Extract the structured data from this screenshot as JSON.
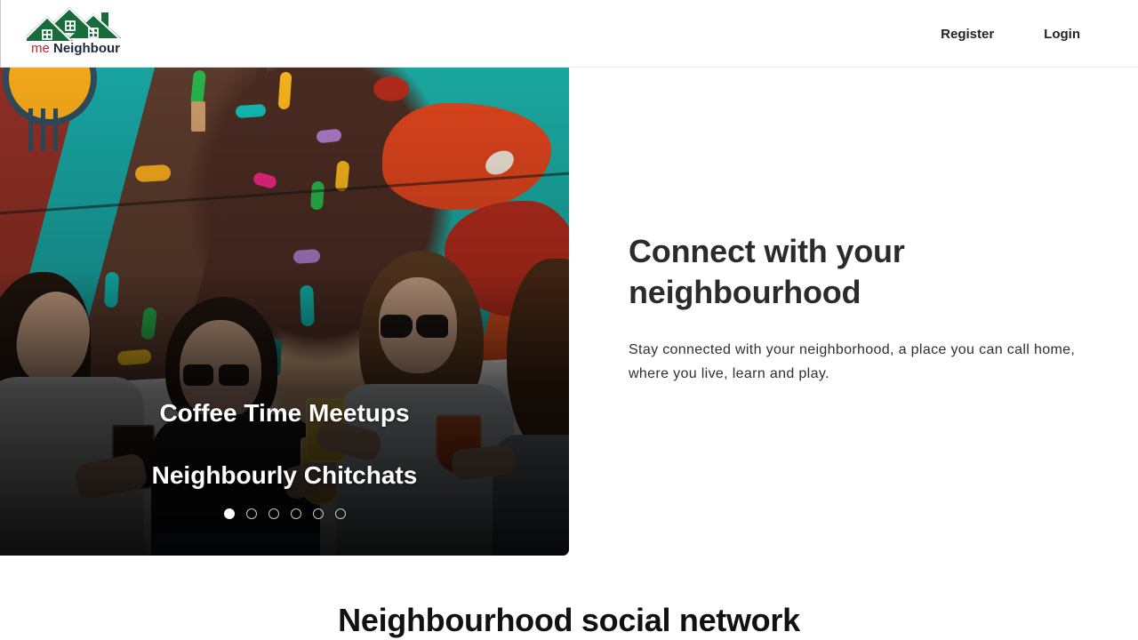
{
  "header": {
    "brand": {
      "icon": "house-roofs-logo-icon",
      "word_primary": "me",
      "word_secondary": "Neighbour",
      "color_primary": "#c0272d",
      "color_secondary": "#1b2a3a",
      "color_roof": "#1a6b3c"
    },
    "nav": {
      "register_label": "Register",
      "login_label": "Login"
    }
  },
  "hero": {
    "carousel": {
      "captions": [
        "Coffee Time Meetups",
        "Neighbourly Chitchats"
      ],
      "dot_count": 6,
      "active_dot_index": 0,
      "image_alt": "Four friends laughing with drinks in front of a colourful street mural"
    },
    "title": "Connect with your neighbourhood",
    "subtitle": "Stay connected with your neighborhood, a place you can call home, where you live, learn and play."
  },
  "section_network": {
    "title": "Neighbourhood social network"
  },
  "colors": {
    "page_background": "#ffffff",
    "text_dark": "#2b2b2b",
    "header_border": "#e8e8e8",
    "dot_active": "#ffffff"
  }
}
